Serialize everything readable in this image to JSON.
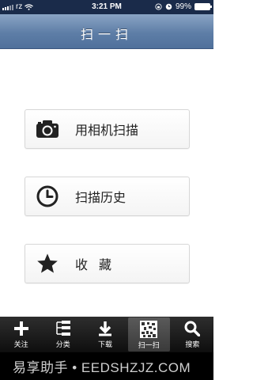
{
  "status_bar": {
    "carrier": "rz",
    "time": "3:21 PM",
    "battery_percent": "99%",
    "battery_level": 0.99
  },
  "nav": {
    "title": "扫一扫"
  },
  "actions": [
    {
      "label": "用相机扫描",
      "icon": "camera-icon"
    },
    {
      "label": "扫描历史",
      "icon": "clock-icon"
    },
    {
      "label": "收藏",
      "icon": "star-icon"
    }
  ],
  "tabs": [
    {
      "label": "关注",
      "icon": "plus-icon"
    },
    {
      "label": "分类",
      "icon": "tree-icon"
    },
    {
      "label": "下载",
      "icon": "download-icon"
    },
    {
      "label": "扫一扫",
      "icon": "qr-code-icon",
      "active": true
    },
    {
      "label": "搜索",
      "icon": "search-icon"
    }
  ],
  "footer": {
    "watermark": "易享助手 • EEDSHZJZ.COM"
  },
  "colors": {
    "nav_top": "#8aa4c4",
    "nav_bottom": "#4f709b",
    "status_bar": "#1a2b4a",
    "tab_bar": "#0e0e0e",
    "icon_dark": "#222222"
  }
}
